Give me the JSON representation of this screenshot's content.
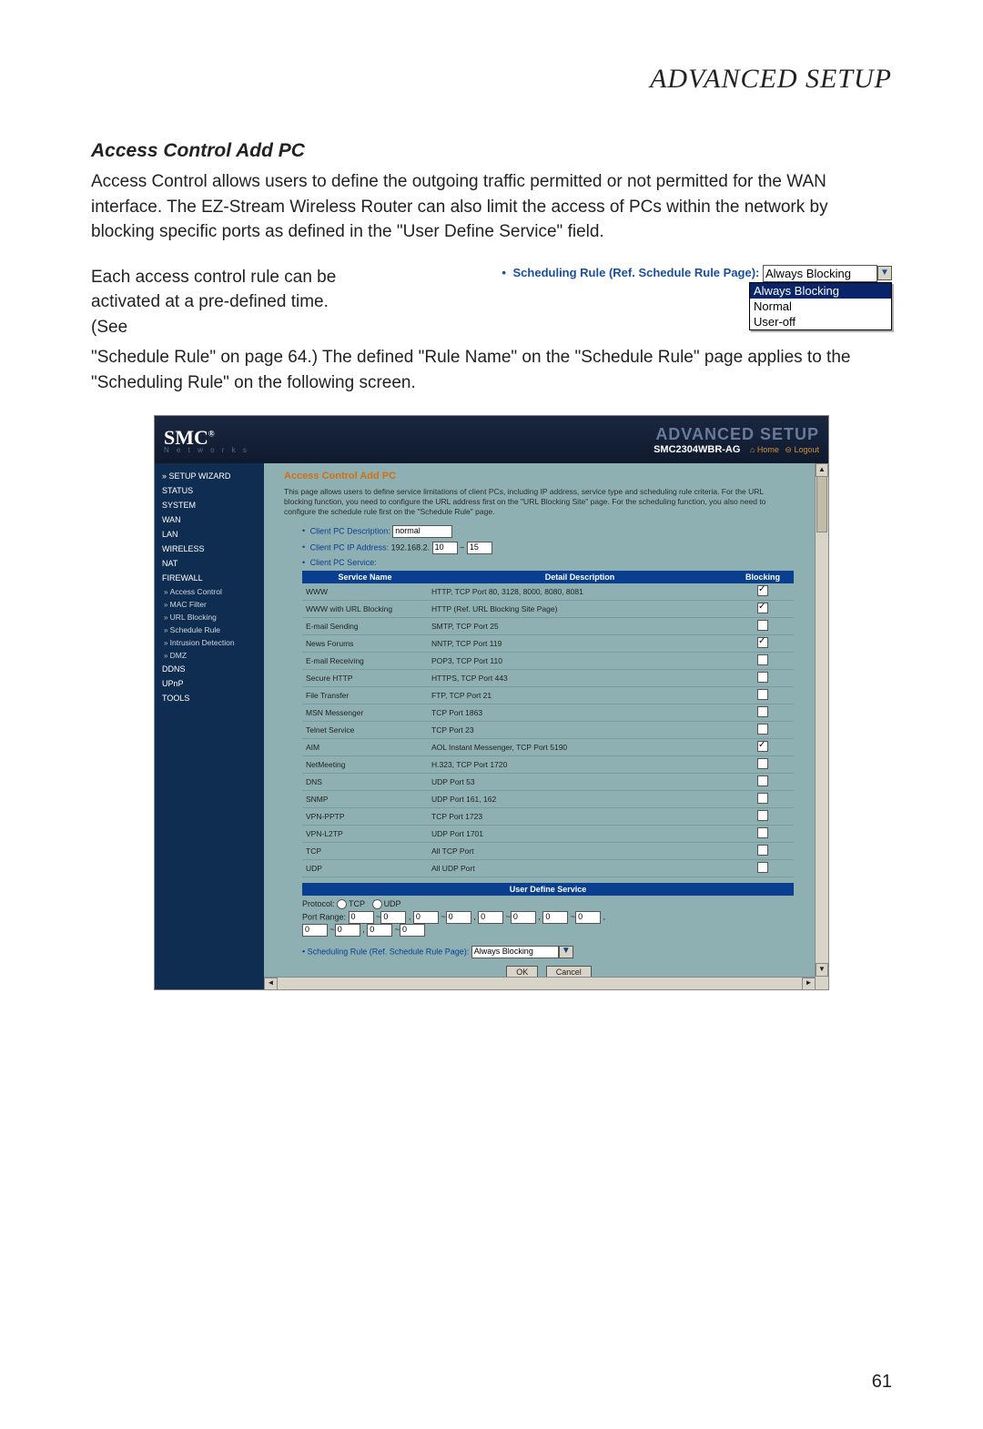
{
  "page": {
    "title": "ADVANCED SETUP",
    "section_heading": "Access Control Add PC",
    "para1": "Access Control allows users to define the outgoing traffic permitted or not permitted for the WAN interface. The EZ-Stream Wireless Router can also limit the access of PCs within the network by blocking specific ports as defined in the \"User Define Service\" field.",
    "para2a": "Each access control rule can be activated at a pre-defined time. (See",
    "para2b": "\"Schedule Rule\" on page 64.) The defined \"Rule Name\" on the \"Schedule Rule\" page applies to the \"Scheduling Rule\" on the following screen.",
    "number": "61"
  },
  "dropdown": {
    "label": "Scheduling Rule (Ref. Schedule Rule Page):",
    "selected": "Always Blocking",
    "options": [
      "Always Blocking",
      "Normal",
      "User-off"
    ]
  },
  "screenshot": {
    "brand": "SMC",
    "brand_sub": "N e t w o r k s",
    "htitle": "ADVANCED SETUP",
    "model": "SMC2304WBR-AG",
    "link_home": "Home",
    "link_logout": "Logout",
    "nav": [
      {
        "label": "SETUP WIZARD",
        "type": "top",
        "first": true
      },
      {
        "label": "STATUS",
        "type": "top"
      },
      {
        "label": "SYSTEM",
        "type": "top"
      },
      {
        "label": "WAN",
        "type": "top"
      },
      {
        "label": "LAN",
        "type": "top"
      },
      {
        "label": "WIRELESS",
        "type": "top"
      },
      {
        "label": "NAT",
        "type": "top"
      },
      {
        "label": "FIREWALL",
        "type": "top"
      },
      {
        "label": "Access Control",
        "type": "sub"
      },
      {
        "label": "MAC Filter",
        "type": "sub"
      },
      {
        "label": "URL Blocking",
        "type": "sub"
      },
      {
        "label": "Schedule Rule",
        "type": "sub"
      },
      {
        "label": "Intrusion Detection",
        "type": "sub"
      },
      {
        "label": "DMZ",
        "type": "sub"
      },
      {
        "label": "DDNS",
        "type": "top"
      },
      {
        "label": "UPnP",
        "type": "top"
      },
      {
        "label": "TOOLS",
        "type": "top"
      }
    ],
    "main": {
      "heading": "Access Control Add PC",
      "desc": "This page allows users to define service limitations of client PCs, including IP address, service type and scheduling rule criteria. For the URL blocking function, you need to configure the URL address first on the \"URL Blocking Site\" page. For the scheduling function, you also need to configure the schedule rule first on the \"Schedule Rule\" page.",
      "field_desc_label": "Client PC Description:",
      "field_desc_value": "normal",
      "field_ip_label": "Client PC IP Address:",
      "field_ip_prefix": "192.168.2.",
      "field_ip_from": "10",
      "field_ip_sep": "~",
      "field_ip_to": "15",
      "field_service_label": "Client PC Service:",
      "col_service": "Service Name",
      "col_detail": "Detail Description",
      "col_block": "Blocking",
      "rows": [
        {
          "name": "WWW",
          "detail": "HTTP, TCP Port 80, 3128, 8000, 8080, 8081",
          "checked": true
        },
        {
          "name": "WWW with URL Blocking",
          "detail": "HTTP (Ref. URL Blocking Site Page)",
          "checked": true
        },
        {
          "name": "E-mail Sending",
          "detail": "SMTP, TCP Port 25",
          "checked": false
        },
        {
          "name": "News Forums",
          "detail": "NNTP, TCP Port 119",
          "checked": true
        },
        {
          "name": "E-mail Receiving",
          "detail": "POP3, TCP Port 110",
          "checked": false
        },
        {
          "name": "Secure HTTP",
          "detail": "HTTPS, TCP Port 443",
          "checked": false
        },
        {
          "name": "File Transfer",
          "detail": "FTP, TCP Port 21",
          "checked": false
        },
        {
          "name": "MSN Messenger",
          "detail": "TCP Port 1863",
          "checked": false
        },
        {
          "name": "Telnet Service",
          "detail": "TCP Port 23",
          "checked": false
        },
        {
          "name": "AIM",
          "detail": "AOL Instant Messenger, TCP Port 5190",
          "checked": true
        },
        {
          "name": "NetMeeting",
          "detail": "H.323, TCP Port 1720",
          "checked": false
        },
        {
          "name": "DNS",
          "detail": "UDP Port 53",
          "checked": false
        },
        {
          "name": "SNMP",
          "detail": "UDP Port 161, 162",
          "checked": false
        },
        {
          "name": "VPN-PPTP",
          "detail": "TCP Port 1723",
          "checked": false
        },
        {
          "name": "VPN-L2TP",
          "detail": "UDP Port 1701",
          "checked": false
        },
        {
          "name": "TCP",
          "detail": "All TCP Port",
          "checked": false
        },
        {
          "name": "UDP",
          "detail": "All UDP Port",
          "checked": false
        }
      ],
      "userdef_header": "User Define Service",
      "protocol_label": "Protocol:",
      "protocol_tcp": "TCP",
      "protocol_udp": "UDP",
      "port_range_label": "Port Range:",
      "port_pairs": [
        [
          "0",
          "0"
        ],
        [
          "0",
          "0"
        ],
        [
          "0",
          "0"
        ],
        [
          "0",
          "0"
        ],
        [
          "0",
          "0"
        ],
        [
          "0",
          "0"
        ]
      ],
      "sched_label": "Scheduling Rule (Ref. Schedule Rule Page):",
      "sched_value": "Always Blocking",
      "btn_ok": "OK",
      "btn_cancel": "Cancel"
    }
  }
}
